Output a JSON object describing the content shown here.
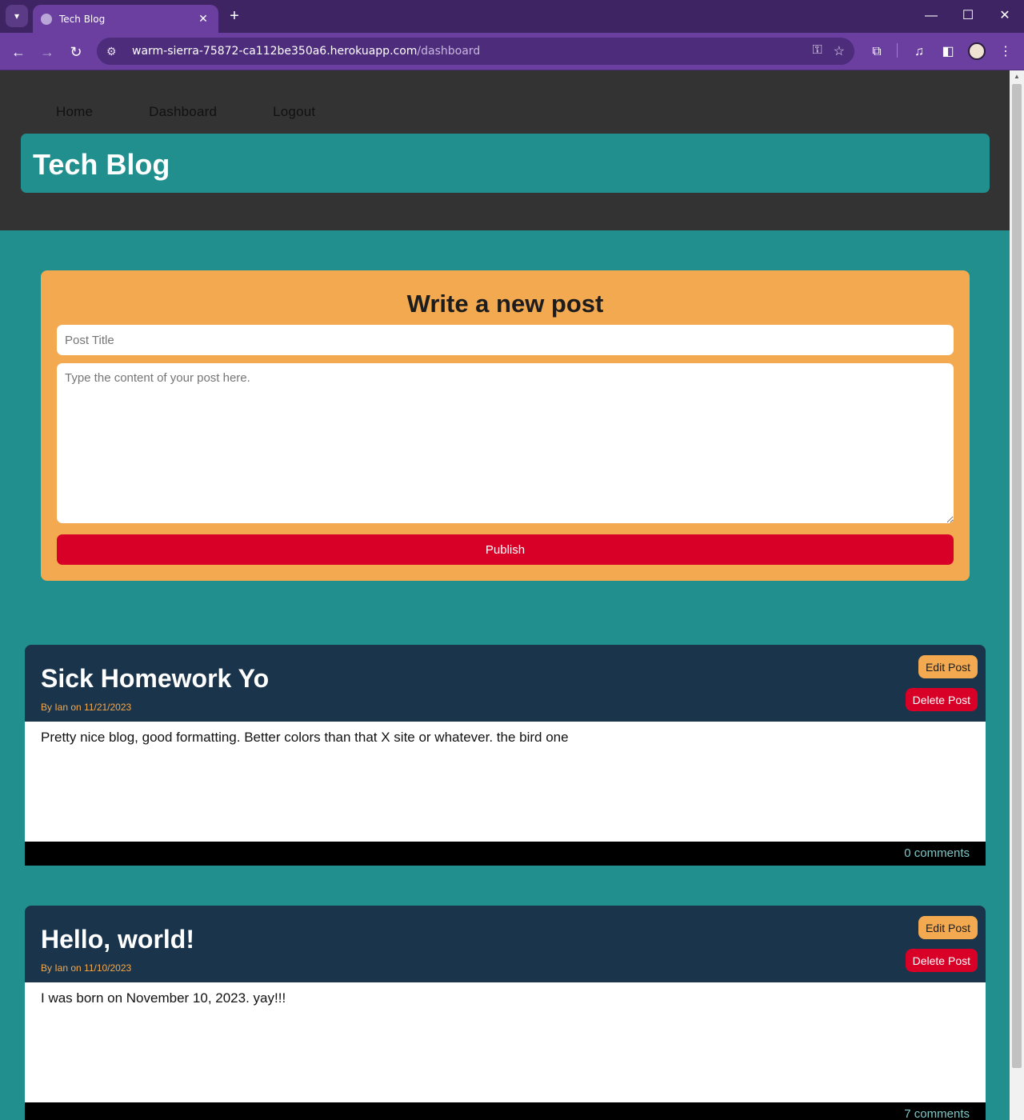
{
  "browser": {
    "tab_title": "Tech Blog",
    "tab_close": "✕",
    "new_tab": "+",
    "url_host": "warm-sierra-75872-ca112be350a6.herokuapp.com",
    "url_path": "/dashboard",
    "window_controls": {
      "minimize": "—",
      "maximize": "☐",
      "close": "✕"
    }
  },
  "nav": {
    "home": "Home",
    "dashboard": "Dashboard",
    "logout": "Logout"
  },
  "brand": {
    "title": "Tech Blog"
  },
  "new_post": {
    "heading": "Write a new post",
    "title_placeholder": "Post Title",
    "content_placeholder": "Type the content of your post here.",
    "publish_label": "Publish"
  },
  "posts": [
    {
      "title": "Sick Homework Yo",
      "meta": "By Ian on 11/21/2023",
      "body": "Pretty nice blog, good formatting. Better colors than that X site or whatever. the bird one",
      "comments": "0 comments",
      "edit_label": "Edit Post",
      "delete_label": "Delete Post"
    },
    {
      "title": "Hello, world!",
      "meta": "By Ian on 11/10/2023",
      "body": "I was born on November 10, 2023. yay!!!",
      "comments": "7 comments",
      "edit_label": "Edit Post",
      "delete_label": "Delete Post"
    }
  ],
  "colors": {
    "browser_frame": "#3f2463",
    "browser_toolbar": "#6a3fa0",
    "header_bg": "#333333",
    "teal": "#208f8e",
    "orange": "#f2a950",
    "red": "#d80027",
    "navy": "#1a344b"
  }
}
